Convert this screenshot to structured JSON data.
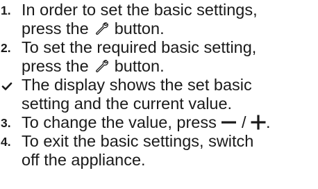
{
  "steps": [
    {
      "marker": "1.",
      "line1": "In order to set the basic settings,",
      "line2_before": "press the",
      "icon": "wrench-icon",
      "line2_after": "button."
    },
    {
      "marker": "2.",
      "line1": "To set the required basic setting,",
      "line2_before": "press the",
      "icon": "wrench-icon",
      "line2_after": "button."
    },
    {
      "marker_icon": "checkmark-icon",
      "line1": "The display shows the set basic",
      "line2": "setting and the current value."
    },
    {
      "marker": "3.",
      "line1_before": "To change the value, press",
      "icon_minus": "minus-icon",
      "separator": "/",
      "icon_plus": "plus-icon",
      "line1_after": "."
    },
    {
      "marker": "4.",
      "line1": "To exit the basic settings, switch",
      "line2": "off the appliance."
    }
  ],
  "colors": {
    "text": "#1a1a1a"
  }
}
